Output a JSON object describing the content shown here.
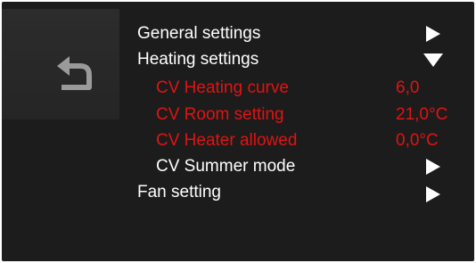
{
  "menu": {
    "items": [
      {
        "label": "General settings",
        "indicator": "arrow-right",
        "level": 0,
        "color": "#ffffff"
      },
      {
        "label": "Heating settings",
        "indicator": "arrow-down",
        "level": 0,
        "color": "#ffffff"
      },
      {
        "label": "CV Heating curve",
        "value": "6,0",
        "level": 1,
        "color": "#e11313"
      },
      {
        "label": "CV Room setting",
        "value": "21,0°C",
        "level": 1,
        "color": "#e11313"
      },
      {
        "label": "CV Heater allowed",
        "value": "0,0°C",
        "level": 1,
        "color": "#e11313"
      },
      {
        "label": "CV Summer mode",
        "indicator": "arrow-right",
        "level": 1,
        "color": "#ffffff"
      },
      {
        "label": "Fan setting",
        "indicator": "arrow-right",
        "level": 0,
        "color": "#ffffff"
      }
    ]
  },
  "back_button": {
    "icon": "back-arrow-icon"
  }
}
